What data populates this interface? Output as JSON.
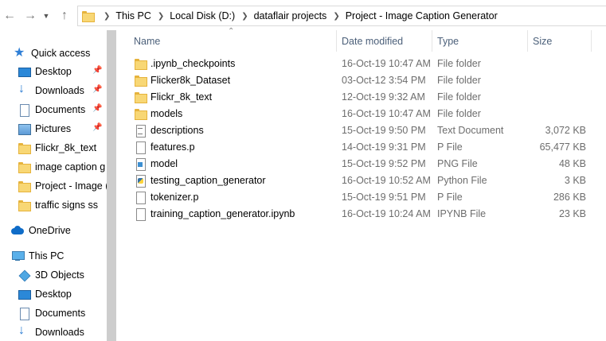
{
  "address_bar": {
    "crumbs": [
      "This PC",
      "Local Disk (D:)",
      "dataflair projects",
      "Project - Image Caption Generator"
    ]
  },
  "sidebar": {
    "quick_access": "Quick access",
    "quick_items": [
      {
        "label": "Desktop",
        "icon": "desktop-icon",
        "pinned": true
      },
      {
        "label": "Downloads",
        "icon": "downloads-icon",
        "pinned": true
      },
      {
        "label": "Documents",
        "icon": "documents-icon",
        "pinned": true
      },
      {
        "label": "Pictures",
        "icon": "pictures-icon",
        "pinned": true
      },
      {
        "label": "Flickr_8k_text",
        "icon": "folder-icon",
        "pinned": false
      },
      {
        "label": "image caption g",
        "icon": "folder-icon",
        "pinned": false
      },
      {
        "label": "Project - Image (",
        "icon": "folder-icon",
        "pinned": false
      },
      {
        "label": "traffic signs ss",
        "icon": "folder-icon",
        "pinned": false
      }
    ],
    "onedrive": "OneDrive",
    "this_pc": "This PC",
    "pc_items": [
      {
        "label": "3D Objects",
        "icon": "3d-objects-icon"
      },
      {
        "label": "Desktop",
        "icon": "desktop-icon"
      },
      {
        "label": "Documents",
        "icon": "documents-icon"
      },
      {
        "label": "Downloads",
        "icon": "downloads-icon"
      }
    ]
  },
  "columns": {
    "name": "Name",
    "date": "Date modified",
    "type": "Type",
    "size": "Size"
  },
  "files": [
    {
      "name": ".ipynb_checkpoints",
      "date": "16-Oct-19 10:47 AM",
      "type": "File folder",
      "size": "",
      "icon": "folder"
    },
    {
      "name": "Flicker8k_Dataset",
      "date": "03-Oct-12 3:54 PM",
      "type": "File folder",
      "size": "",
      "icon": "folder"
    },
    {
      "name": "Flickr_8k_text",
      "date": "12-Oct-19 9:32 AM",
      "type": "File folder",
      "size": "",
      "icon": "folder"
    },
    {
      "name": "models",
      "date": "16-Oct-19 10:47 AM",
      "type": "File folder",
      "size": "",
      "icon": "folder"
    },
    {
      "name": "descriptions",
      "date": "15-Oct-19 9:50 PM",
      "type": "Text Document",
      "size": "3,072 KB",
      "icon": "text"
    },
    {
      "name": "features.p",
      "date": "14-Oct-19 9:31 PM",
      "type": "P File",
      "size": "65,477 KB",
      "icon": "file"
    },
    {
      "name": "model",
      "date": "15-Oct-19 9:52 PM",
      "type": "PNG File",
      "size": "48 KB",
      "icon": "png"
    },
    {
      "name": "testing_caption_generator",
      "date": "16-Oct-19 10:52 AM",
      "type": "Python File",
      "size": "3 KB",
      "icon": "python"
    },
    {
      "name": "tokenizer.p",
      "date": "15-Oct-19 9:51 PM",
      "type": "P File",
      "size": "286 KB",
      "icon": "file"
    },
    {
      "name": "training_caption_generator.ipynb",
      "date": "16-Oct-19 10:24 AM",
      "type": "IPYNB File",
      "size": "23 KB",
      "icon": "file"
    }
  ]
}
